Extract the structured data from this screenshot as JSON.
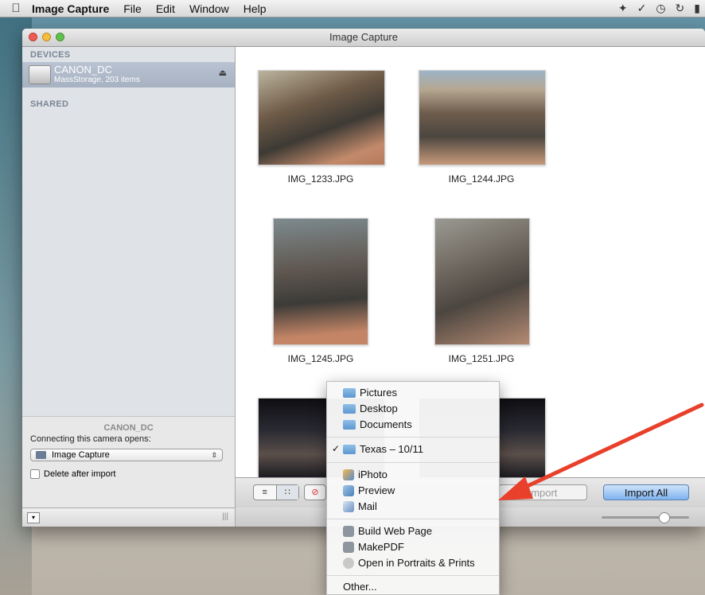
{
  "menubar": {
    "app_name": "Image Capture",
    "items": [
      "File",
      "Edit",
      "Window",
      "Help"
    ]
  },
  "window": {
    "title": "Image Capture"
  },
  "sidebar": {
    "devices_header": "DEVICES",
    "device_name": "CANON_DC",
    "device_sub": "MassStorage, 203 items",
    "shared_header": "SHARED",
    "bottom_device": "CANON_DC",
    "connecting_label": "Connecting this camera opens:",
    "opens_app": "Image Capture",
    "delete_label": "Delete after import"
  },
  "thumbs": [
    "IMG_1233.JPG",
    "IMG_1244.JPG",
    "IMG_1245.JPG",
    "IMG_1251.JPG"
  ],
  "toolbar": {
    "import_label": "Import",
    "import_all_label": "Import All"
  },
  "import_menu": {
    "folders": [
      "Pictures",
      "Desktop",
      "Documents"
    ],
    "selected": "Texas – 10/11",
    "apps": [
      "iPhoto",
      "Preview",
      "Mail"
    ],
    "workflows": [
      "Build Web Page",
      "MakePDF",
      "Open in Portraits & Prints"
    ],
    "other": "Other..."
  },
  "colors": {
    "accent": "#7fb3ef",
    "arrow": "#e8402b"
  }
}
